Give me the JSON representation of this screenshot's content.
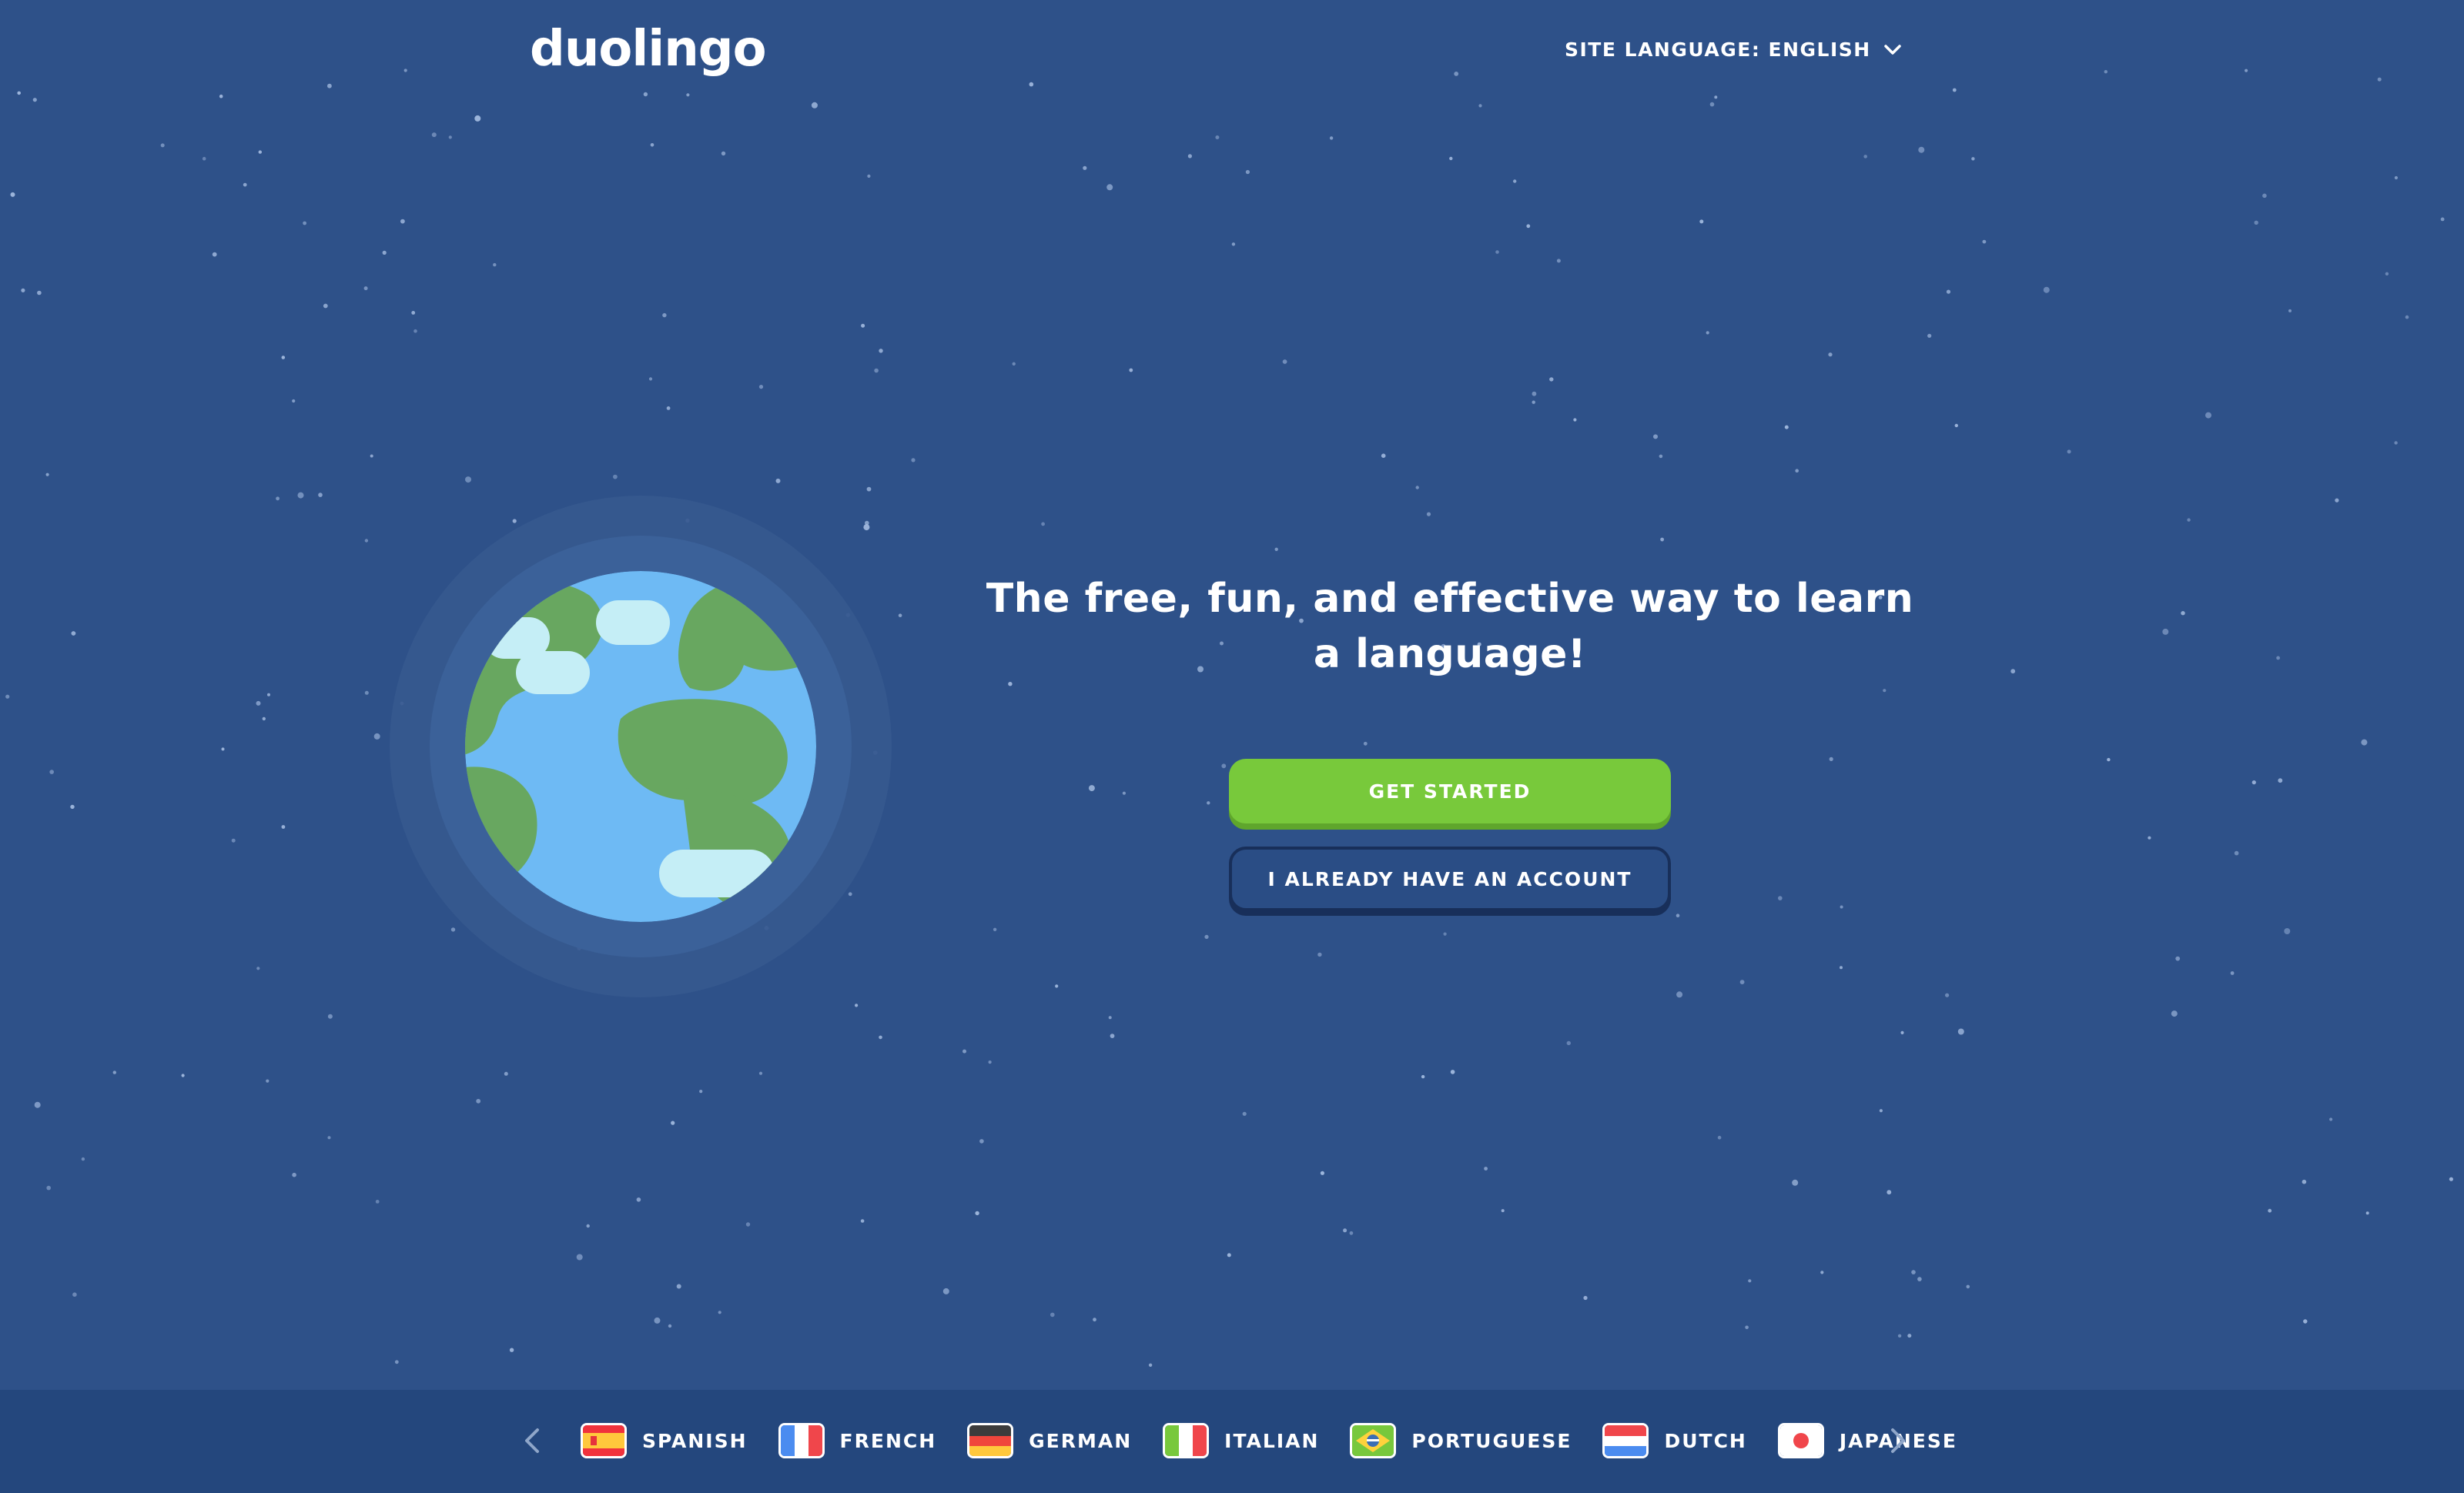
{
  "header": {
    "logo_text": "duolingo",
    "site_language_label": "SITE LANGUAGE: ENGLISH"
  },
  "hero": {
    "headline": "The free, fun, and effective way to learn a language!",
    "get_started_label": "GET STARTED",
    "have_account_label": "I ALREADY HAVE AN ACCOUNT"
  },
  "colors": {
    "background": "#2e5189",
    "language_bar": "#24477d",
    "primary_button": "#78c93b",
    "secondary_button_border": "#182f5a"
  },
  "language_bar": {
    "previous_icon": "chevron-left-icon",
    "next_icon": "chevron-right-icon",
    "languages": [
      {
        "label": "SPANISH",
        "flag_icon": "spain-flag-icon"
      },
      {
        "label": "FRENCH",
        "flag_icon": "france-flag-icon"
      },
      {
        "label": "GERMAN",
        "flag_icon": "germany-flag-icon"
      },
      {
        "label": "ITALIAN",
        "flag_icon": "italy-flag-icon"
      },
      {
        "label": "PORTUGUESE",
        "flag_icon": "brazil-flag-icon"
      },
      {
        "label": "DUTCH",
        "flag_icon": "netherlands-flag-icon"
      },
      {
        "label": "JAPANESE",
        "flag_icon": "japan-flag-icon"
      }
    ]
  }
}
